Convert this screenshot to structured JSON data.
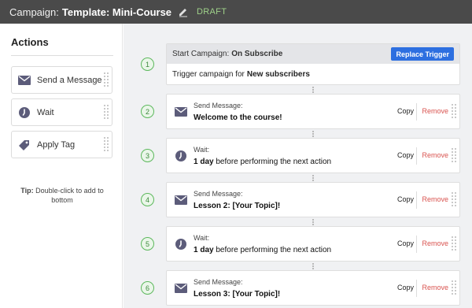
{
  "header": {
    "prefix": "Campaign:",
    "name": "Template: Mini-Course",
    "status": "DRAFT",
    "edit_icon": "pencil-icon"
  },
  "sidebar": {
    "title": "Actions",
    "items": [
      {
        "label": "Send a Message",
        "icon": "envelope-icon"
      },
      {
        "label": "Wait",
        "icon": "clock-icon"
      },
      {
        "label": "Apply Tag",
        "icon": "tag-icon"
      }
    ],
    "tip_label": "Tip:",
    "tip_text": "Double-click to add to bottom"
  },
  "trigger": {
    "number": "1",
    "label": "Start Campaign:",
    "value": "On Subscribe",
    "button": "Replace Trigger",
    "body_prefix": "Trigger campaign for",
    "body_value": "New subscribers"
  },
  "steps": [
    {
      "number": "2",
      "type": "message",
      "small": "Send Message:",
      "bold": "Welcome to the course!",
      "rest": ""
    },
    {
      "number": "3",
      "type": "wait",
      "small": "Wait:",
      "bold": "1 day",
      "rest": " before performing the next action"
    },
    {
      "number": "4",
      "type": "message",
      "small": "Send Message:",
      "bold": "Lesson 2: [Your Topic]!",
      "rest": ""
    },
    {
      "number": "5",
      "type": "wait",
      "small": "Wait:",
      "bold": "1 day",
      "rest": " before performing the next action"
    },
    {
      "number": "6",
      "type": "message",
      "small": "Send Message:",
      "bold": "Lesson 3: [Your Topic]!",
      "rest": ""
    }
  ],
  "step_actions": {
    "copy": "Copy",
    "remove": "Remove"
  },
  "colors": {
    "accent": "#2d6fe0",
    "remove": "#d9534f",
    "step_number": "#5cb85c",
    "status": "#9fd18a"
  }
}
